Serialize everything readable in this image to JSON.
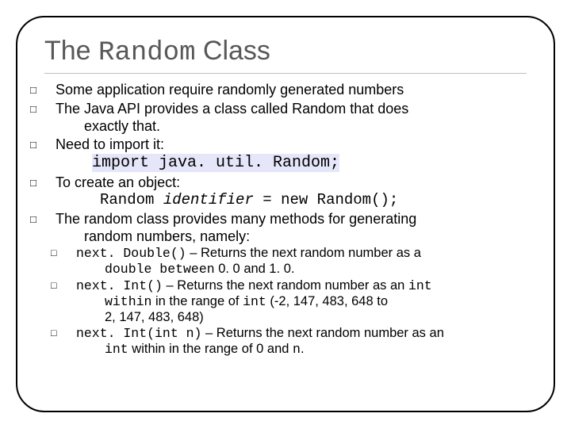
{
  "title": {
    "pre": "The ",
    "mono": "Random",
    "post": " Class"
  },
  "bullets": {
    "b1": "Some application require randomly generated numbers",
    "b2a": "The Java API provides a class called Random that does",
    "b2b": "exactly that.",
    "b3": "Need to import it:",
    "import": "import java. util. Random;",
    "b4": "To create an object:",
    "newrand_a": "Random ",
    "newrand_b": "identifier",
    "newrand_c": " = new Random();",
    "b5a": "The random class provides many methods for generating",
    "b5b": "random numbers, namely:"
  },
  "sub": {
    "s1code": "next. Double()",
    "s1dash": " – ",
    "s1text": "Returns the next random number as a",
    "s1line2a": "double between",
    "s1line2b": " 0. 0 and 1. 0.",
    "s2code": "next. Int()",
    "s2dash": " – ",
    "s2text": "Returns the next random number as an ",
    "s2int": "int",
    "s2line2a": "within",
    "s2line2b": " in the range of ",
    "s2line2c": "int",
    "s2line2d": " (-2, 147, 483, 648 to",
    "s2line3": "2, 147, 483, 648)",
    "s3code": "next. Int(int n)",
    "s3dash": " – ",
    "s3text": "Returns the next random number as an",
    "s3line2a": "int",
    "s3line2b": " within in the range of 0 and ",
    "s3line2c": "n",
    "s3line2d": "."
  },
  "glyph": "□"
}
